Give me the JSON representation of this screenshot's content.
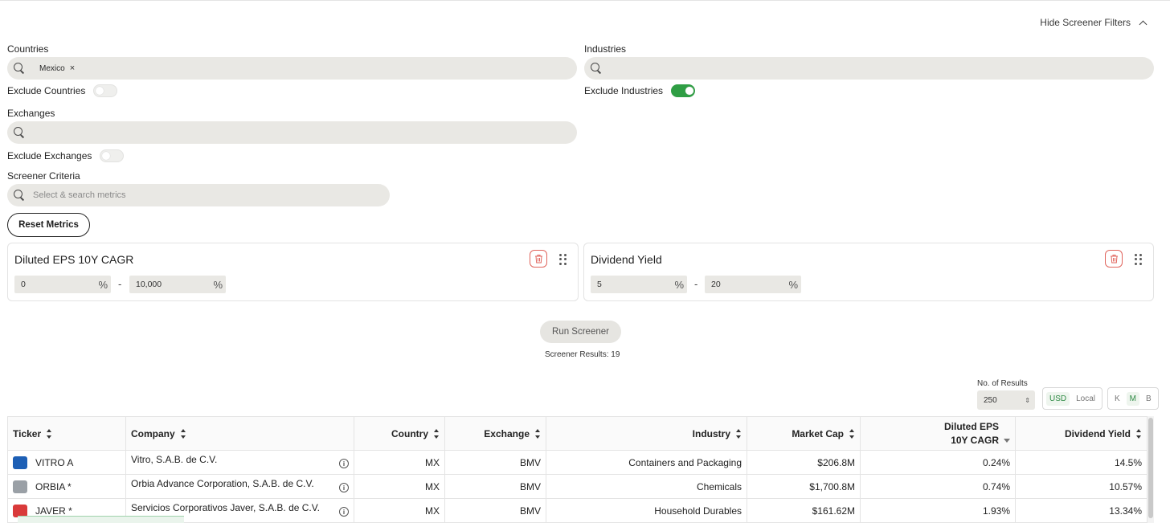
{
  "header": {
    "hide_filters_label": "Hide Screener Filters"
  },
  "countries": {
    "label": "Countries",
    "chip": "Mexico",
    "exclude_label": "Exclude Countries",
    "exclude_on": false
  },
  "industries": {
    "label": "Industries",
    "exclude_label": "Exclude Industries",
    "exclude_on": true
  },
  "exchanges": {
    "label": "Exchanges",
    "exclude_label": "Exclude Exchanges",
    "exclude_on": false
  },
  "criteria": {
    "label": "Screener Criteria",
    "placeholder": "Select & search metrics"
  },
  "reset_label": "Reset Metrics",
  "metrics": [
    {
      "title": "Diluted EPS 10Y CAGR",
      "min": "0",
      "max": "10,000",
      "unit": "%",
      "separator": "-"
    },
    {
      "title": "Dividend Yield",
      "min": "5",
      "max": "20",
      "unit": "%",
      "separator": "-"
    }
  ],
  "run_label": "Run Screener",
  "results_text": "Screener Results: 19",
  "results_controls": {
    "count_label": "No. of Results",
    "count_value": "250",
    "currency": [
      "USD",
      "Local"
    ],
    "currency_active": "USD",
    "scale": [
      "K",
      "M",
      "B"
    ],
    "scale_active": "M"
  },
  "table": {
    "headers": [
      "Ticker",
      "Company",
      "Country",
      "Exchange",
      "Industry",
      "Market Cap",
      "Diluted EPS 10Y CAGR",
      "Dividend Yield"
    ],
    "rows": [
      {
        "ticker": "VITRO A",
        "company": "Vitro, S.A.B. de C.V.",
        "country": "MX",
        "exchange": "BMV",
        "industry": "Containers and Packaging",
        "market_cap": "$206.8M",
        "eps_cagr": "0.24%",
        "div_yield": "14.5%",
        "logo_color": "#1d5fb5"
      },
      {
        "ticker": "ORBIA *",
        "company": "Orbia Advance Corporation, S.A.B. de C.V.",
        "country": "MX",
        "exchange": "BMV",
        "industry": "Chemicals",
        "market_cap": "$1,700.8M",
        "eps_cagr": "0.74%",
        "div_yield": "10.57%",
        "logo_color": "#9aa0a6"
      },
      {
        "ticker": "JAVER *",
        "company": "Servicios Corporativos Javer, S.A.B. de C.V.",
        "country": "MX",
        "exchange": "BMV",
        "industry": "Household Durables",
        "market_cap": "$161.62M",
        "eps_cagr": "1.93%",
        "div_yield": "13.34%",
        "logo_color": "#d93a3a"
      }
    ]
  }
}
